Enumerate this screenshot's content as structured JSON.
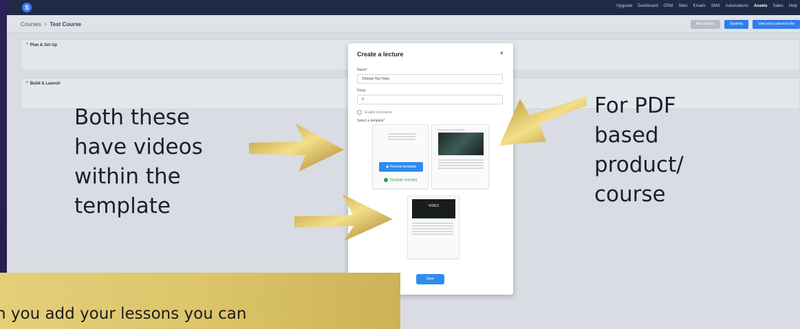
{
  "nav": {
    "items": [
      "Upgrade",
      "Dashboard",
      "CRM",
      "Sites",
      "Emails",
      "SMS",
      "Automations",
      "Assets",
      "Sales",
      "Help"
    ]
  },
  "breadcrumb": {
    "root": "Courses",
    "separator": ">",
    "current": "Test Course"
  },
  "toolbar": {
    "add_student": "Add student",
    "students": "Students",
    "view_customize": "View and customize the"
  },
  "sections": {
    "plan": "Plan & Set Up",
    "build": "Build & Launch"
  },
  "modal": {
    "title": "Create a lecture",
    "close": "×",
    "name_label": "Name",
    "name_value": "Choose You Tools",
    "delay_label": "Delay",
    "delay_value": "0",
    "enable_comments": "Enable comments",
    "select_template_label": "Select a template",
    "preview_template": "Preview template",
    "template_selected": "Template selected",
    "video_label": "VIDEO",
    "save": "Save"
  },
  "annotations": {
    "left": [
      "Both these",
      "have videos",
      "within the",
      "template"
    ],
    "right": [
      "For PDF",
      "based",
      "product/",
      "course"
    ],
    "banner": "n you add your lessons you can"
  },
  "colors": {
    "outer_bg": "#221a44",
    "primary_button": "#2f8bf0",
    "success": "#2c9a4c",
    "gold": "#dcc56a"
  }
}
